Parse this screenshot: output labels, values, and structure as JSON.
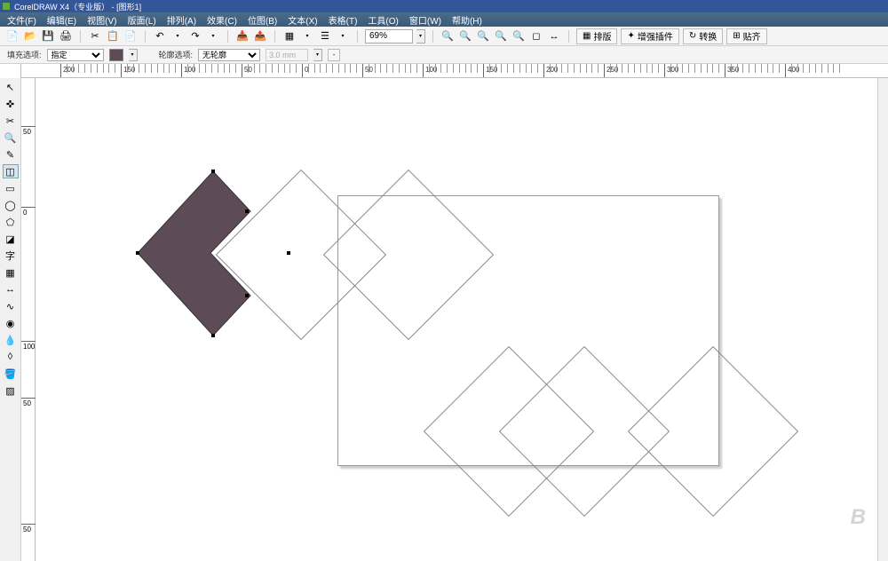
{
  "title": "CorelDRAW X4（专业版） - [图形1]",
  "menu": [
    "文件(F)",
    "编辑(E)",
    "视图(V)",
    "版面(L)",
    "排列(A)",
    "效果(C)",
    "位图(B)",
    "文本(X)",
    "表格(T)",
    "工具(O)",
    "窗口(W)",
    "帮助(H)"
  ],
  "zoom": "69%",
  "toolbar_big": [
    "排版",
    "增强插件",
    "转换",
    "贴齐"
  ],
  "prop": {
    "fill_label": "填充选项:",
    "fill_select": "指定",
    "outline_label": "轮廓选项:",
    "outline_select": "无轮廓",
    "width_disabled": "3.0 mm"
  },
  "ruler_h": [
    {
      "p": 44,
      "v": "200"
    },
    {
      "p": 112,
      "v": "150"
    },
    {
      "p": 180,
      "v": "100"
    },
    {
      "p": 248,
      "v": "50"
    },
    {
      "p": 316,
      "v": "0"
    },
    {
      "p": 384,
      "v": "50"
    },
    {
      "p": 452,
      "v": "100"
    },
    {
      "p": 520,
      "v": "150"
    },
    {
      "p": 588,
      "v": "200"
    },
    {
      "p": 656,
      "v": "250"
    },
    {
      "p": 724,
      "v": "300"
    },
    {
      "p": 792,
      "v": "350"
    },
    {
      "p": 860,
      "v": "400"
    }
  ],
  "ruler_v": [
    {
      "p": 54,
      "v": "50"
    },
    {
      "p": 145,
      "v": "0"
    },
    {
      "p": 296,
      "v": "100"
    },
    {
      "p": 360,
      "v": "50"
    },
    {
      "p": 502,
      "v": "50"
    }
  ],
  "watermark": "B"
}
